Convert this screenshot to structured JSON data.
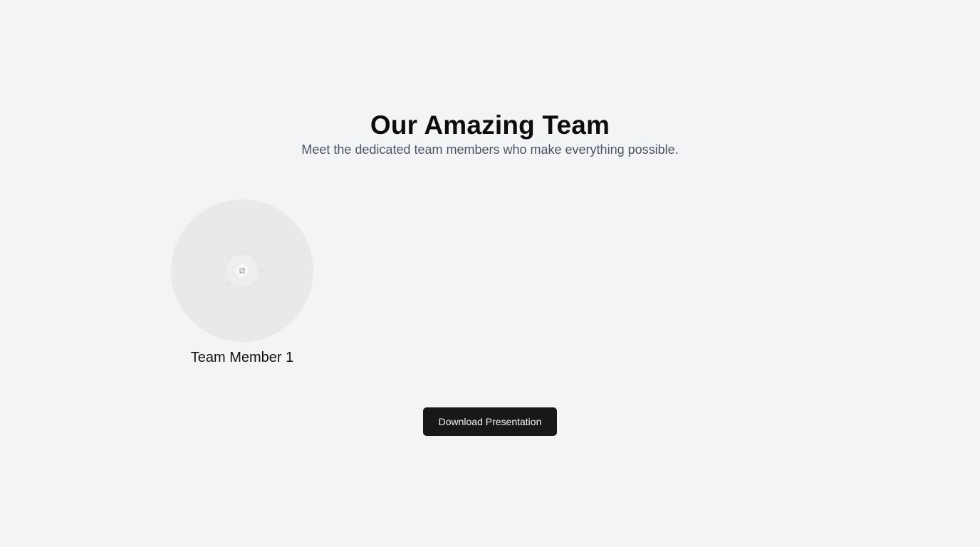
{
  "header": {
    "title": "Our Amazing Team",
    "subtitle": "Meet the dedicated team members who make everything possible."
  },
  "team": {
    "members": [
      {
        "name": "Team Member 1",
        "avatar_icon": "image-placeholder-icon"
      }
    ]
  },
  "actions": {
    "download_label": "Download Presentation"
  },
  "colors": {
    "background": "#f2f4f6",
    "button": "#18181b",
    "avatar_placeholder": "#e9e9ea"
  }
}
